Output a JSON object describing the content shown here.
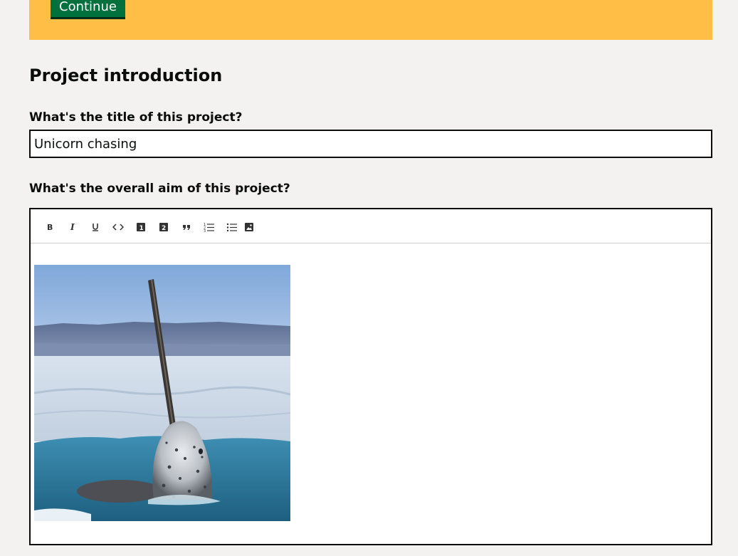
{
  "banner": {
    "continue_label": "Continue",
    "color": "#ffbf47"
  },
  "section": {
    "title": "Project introduction"
  },
  "questions": {
    "title_label": "What's the title of this project?",
    "title_value": "Unicorn chasing",
    "aim_label": "What's the overall aim of this project?"
  },
  "editor": {
    "toolbar": [
      {
        "name": "bold-icon"
      },
      {
        "name": "italic-icon"
      },
      {
        "name": "underline-icon"
      },
      {
        "name": "code-icon"
      },
      {
        "name": "heading-1-icon"
      },
      {
        "name": "heading-2-icon"
      },
      {
        "name": "quote-icon"
      },
      {
        "name": "numbered-list-icon"
      },
      {
        "name": "bulleted-list-icon"
      },
      {
        "name": "image-icon"
      }
    ],
    "image_subject": "narwhal-photo"
  }
}
